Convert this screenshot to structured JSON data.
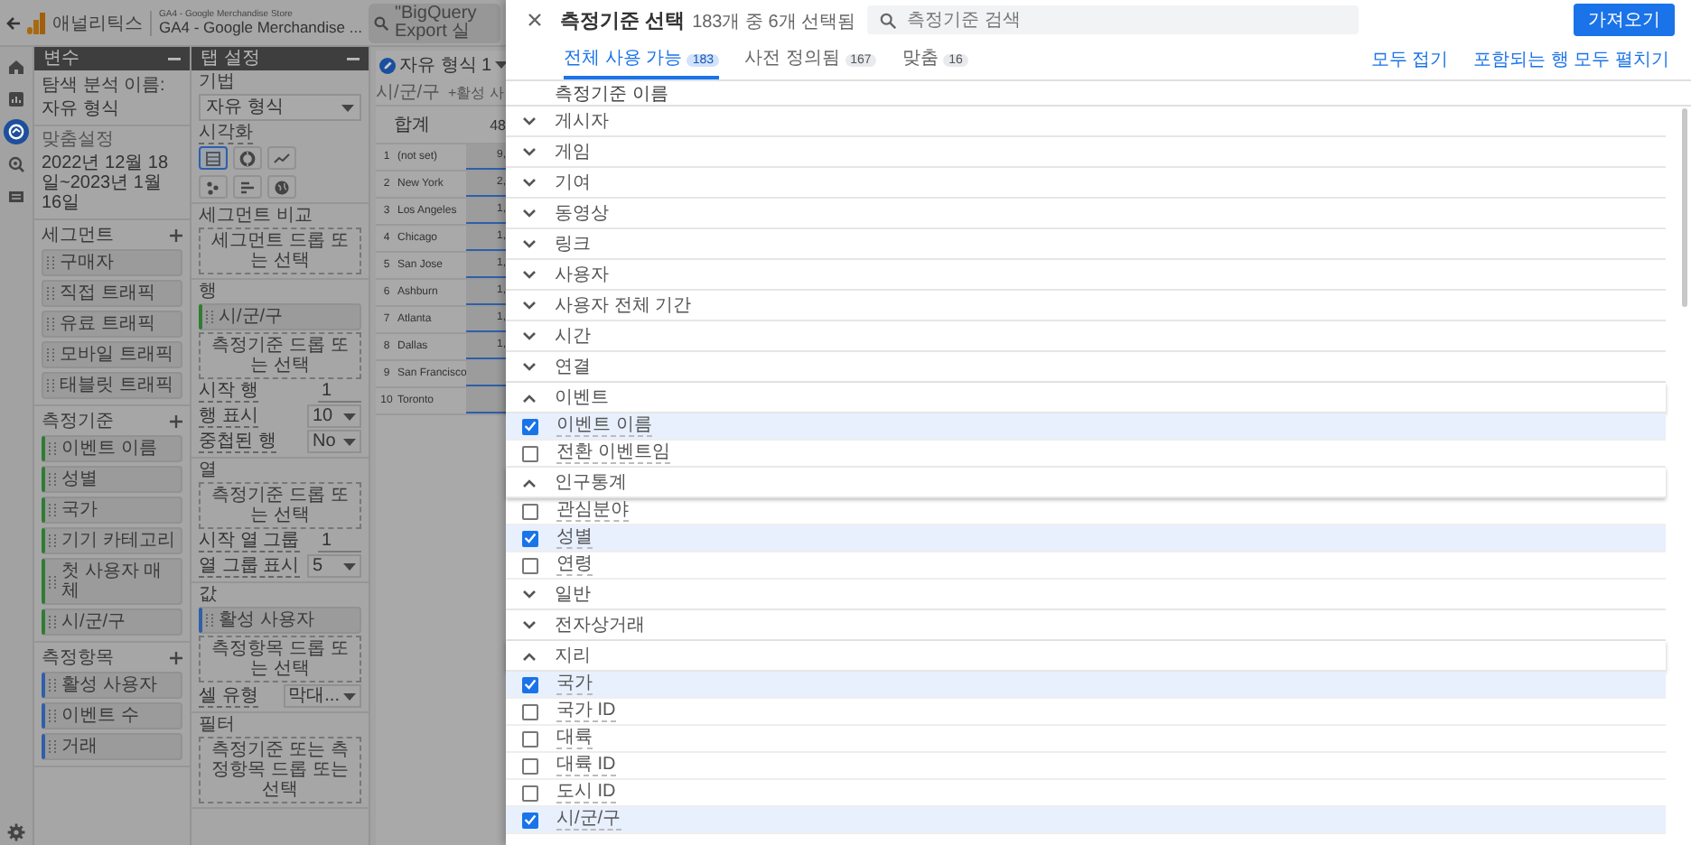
{
  "app_header": {
    "product": "애널리틱스",
    "account": "GA4 - Google Merchandise Store",
    "property": "GA4 - Google Merchandise ...",
    "search": {
      "value": "\"BigQuery Export 실"
    }
  },
  "nav_rail": [
    {
      "selected": false
    },
    {
      "selected": false
    },
    {
      "selected": true
    },
    {
      "selected": false
    },
    {
      "selected": false
    }
  ],
  "variables_panel": {
    "title": "변수",
    "name_label": "탐색 분석 이름:",
    "name": "자유 형식",
    "date_label": "맞춤설정",
    "date_range": "2022년 12월 18일~2023년 1월 16일",
    "sections": [
      {
        "title": "세그먼트",
        "kind": "segment",
        "items": [
          "구매자",
          "직접 트래픽",
          "유료 트래픽",
          "모바일 트래픽",
          "태블릿 트래픽"
        ]
      },
      {
        "title": "측정기준",
        "kind": "dimension",
        "items": [
          "이벤트 이름",
          "성별",
          "국가",
          "기기 카테고리",
          "첫 사용자 매체",
          "시/군/구"
        ]
      },
      {
        "title": "측정항목",
        "kind": "metric",
        "items": [
          "활성 사용자",
          "이벤트 수",
          "거래"
        ]
      }
    ]
  },
  "tab_settings": {
    "title": "탭 설정",
    "technique": {
      "label": "기법",
      "value": "자유 형식"
    },
    "visualization": {
      "label": "시각화",
      "options": [
        {
          "selected": true
        },
        {
          "selected": false
        },
        {
          "selected": false
        },
        {
          "selected": false
        },
        {
          "selected": false
        },
        {
          "selected": false
        }
      ]
    },
    "sections": [
      {
        "label": "세그먼트 비교",
        "drop": "세그먼트 드롭 또는 선택"
      },
      {
        "label": "행",
        "kind": "dimension",
        "chips": [
          "시/군/구"
        ],
        "drop": "측정기준 드롭 또는 선택",
        "fields": [
          {
            "kind": "number",
            "label": "시작 행",
            "value": "1"
          },
          {
            "kind": "select",
            "label": "행 표시",
            "value": "10"
          },
          {
            "kind": "select",
            "label": "중첩된 행",
            "value": "No"
          }
        ]
      },
      {
        "label": "열",
        "drop": "측정기준 드롭 또는 선택",
        "fields": [
          {
            "kind": "number",
            "label": "시작 열 그룹",
            "value": "1"
          },
          {
            "kind": "select",
            "label": "열 그룹 표시",
            "value": "5"
          }
        ]
      },
      {
        "label": "값",
        "kind": "metric",
        "chips": [
          "활성 사용자"
        ],
        "drop": "측정항목 드롭 또는 선택",
        "fields": [
          {
            "kind": "select",
            "label": "셀 유형",
            "value": "막대..."
          }
        ]
      },
      {
        "label": "필터",
        "drop": "측정기준 또는 측정항목 드롭 또는 선택"
      }
    ]
  },
  "report": {
    "tab": {
      "label": "자유 형식 1"
    },
    "columns": [
      "시/군/구",
      "+활성 사"
    ],
    "total_label": "합계",
    "total_value": "48",
    "rows": [
      {
        "index": "1",
        "city": "(not set)",
        "value": "9,"
      },
      {
        "index": "2",
        "city": "New York",
        "value": "2,"
      },
      {
        "index": "3",
        "city": "Los Angeles",
        "value": "1,"
      },
      {
        "index": "4",
        "city": "Chicago",
        "value": "1,"
      },
      {
        "index": "5",
        "city": "San Jose",
        "value": "1,"
      },
      {
        "index": "6",
        "city": "Ashburn",
        "value": "1,"
      },
      {
        "index": "7",
        "city": "Atlanta",
        "value": "1,"
      },
      {
        "index": "8",
        "city": "Dallas",
        "value": "1,"
      },
      {
        "index": "9",
        "city": "San Francisco"
      },
      {
        "index": "10",
        "city": "Toronto"
      }
    ]
  },
  "dimension_picker": {
    "title": "측정기준 선택",
    "selection_count": "183개 중 6개 선택됨",
    "search": {
      "placeholder": "측정기준 검색"
    },
    "import_button": "가져오기",
    "tabs": [
      {
        "label": "전체 사용 가능",
        "count": "183",
        "selected": true
      },
      {
        "label": "사전 정의됨",
        "count": "167",
        "selected": false
      },
      {
        "label": "맞춤",
        "count": "16",
        "selected": false
      }
    ],
    "actions": [
      "모두 접기",
      "포함되는 행 모두 펼치기"
    ],
    "column_header": "측정기준 이름",
    "groups": [
      {
        "label": "게시자",
        "expanded": false
      },
      {
        "label": "게임",
        "expanded": false
      },
      {
        "label": "기여",
        "expanded": false
      },
      {
        "label": "동영상",
        "expanded": false
      },
      {
        "label": "링크",
        "expanded": false
      },
      {
        "label": "사용자",
        "expanded": false
      },
      {
        "label": "사용자 전체 기간",
        "expanded": false
      },
      {
        "label": "시간",
        "expanded": false
      },
      {
        "label": "연결",
        "expanded": false
      },
      {
        "label": "이벤트",
        "expanded": true,
        "children": [
          {
            "label": "이벤트 이름",
            "checked": true
          },
          {
            "label": "전환 이벤트임",
            "checked": false
          }
        ]
      },
      {
        "label": "인구통계",
        "expanded": true,
        "children": [
          {
            "label": "관심분야",
            "checked": false
          },
          {
            "label": "성별",
            "checked": true
          },
          {
            "label": "연령",
            "checked": false
          }
        ]
      },
      {
        "label": "일반",
        "expanded": false
      },
      {
        "label": "전자상거래",
        "expanded": false
      },
      {
        "label": "지리",
        "expanded": true,
        "children": [
          {
            "label": "국가",
            "checked": true
          },
          {
            "label": "국가 ID",
            "checked": false
          },
          {
            "label": "대륙",
            "checked": false
          },
          {
            "label": "대륙 ID",
            "checked": false
          },
          {
            "label": "도시 ID",
            "checked": false
          },
          {
            "label": "시/군/구",
            "checked": true
          }
        ]
      }
    ]
  }
}
